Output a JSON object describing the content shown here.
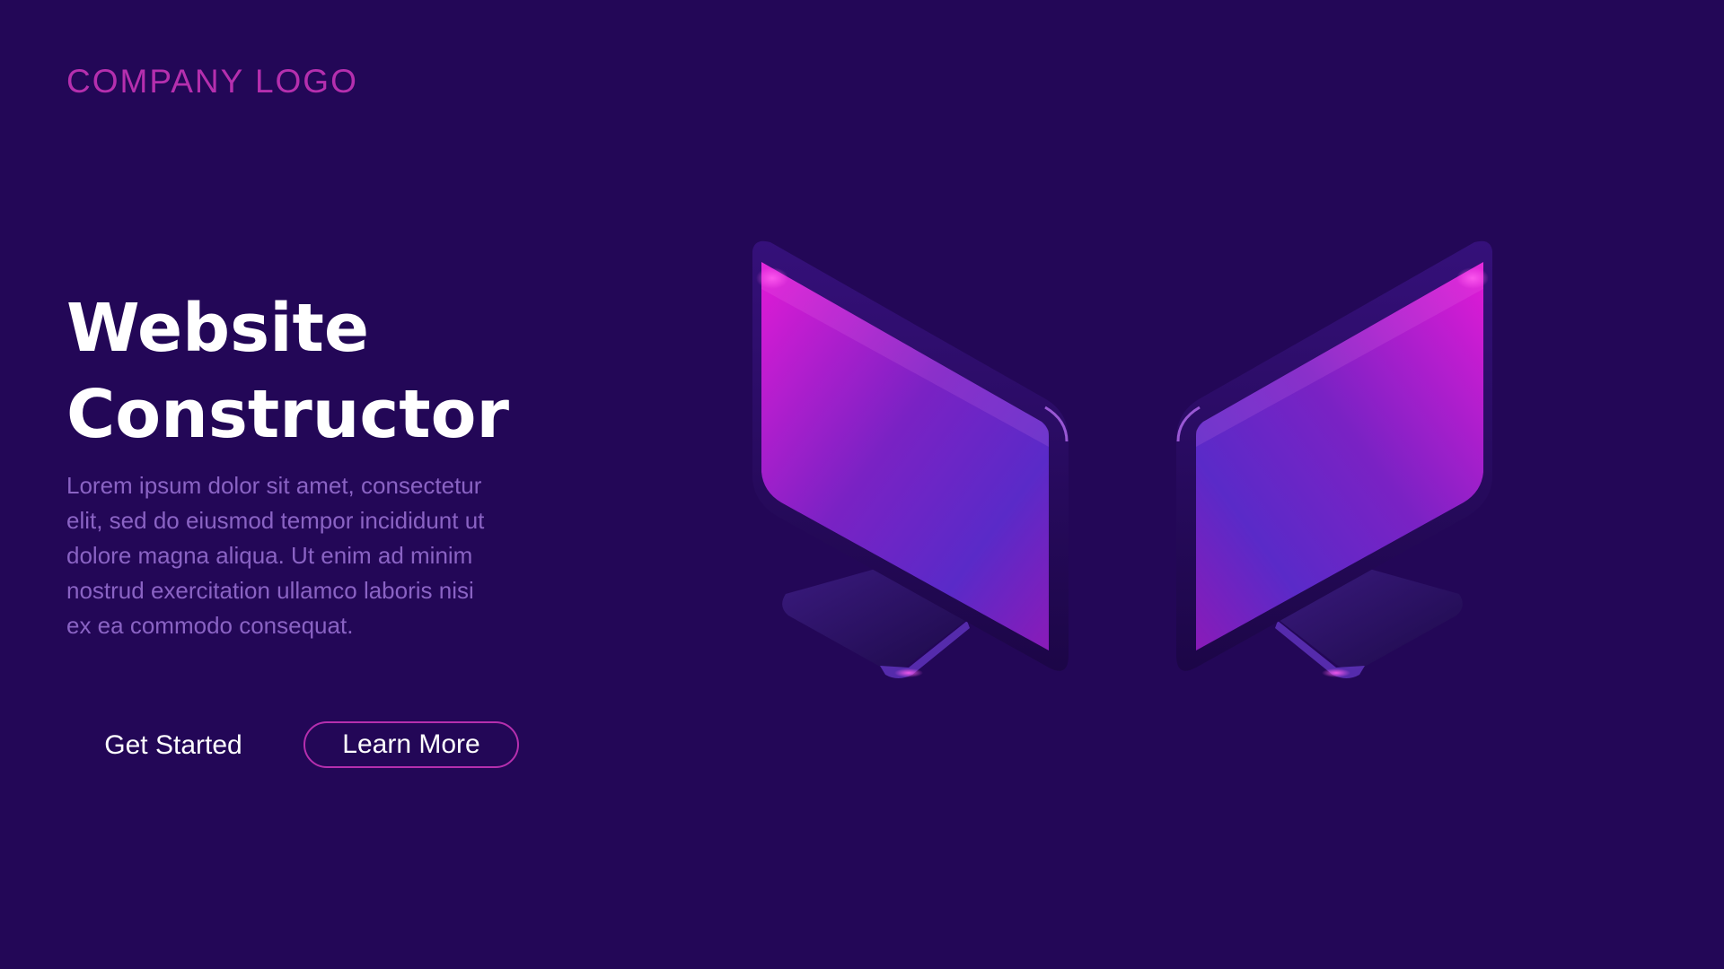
{
  "brand": {
    "logo_text": "COMPANY LOGO"
  },
  "hero": {
    "title_lines": [
      "Website",
      "Constructor"
    ],
    "description_lines": [
      "Lorem ipsum dolor sit amet, consectetur",
      "elit, sed do eiusmod tempor incididunt ut",
      "dolore magna aliqua. Ut enim ad minim",
      "nostrud exercitation ullamco laboris nisi",
      "ex ea commodo consequat."
    ]
  },
  "actions": {
    "get_started_label": "Get Started",
    "learn_more_label": "Learn More"
  },
  "illustration": {
    "icons": [
      "monitor-icon",
      "monitor-icon"
    ]
  },
  "colors": {
    "background": "#230757",
    "accent": "#b52fae",
    "title": "#ffffff",
    "body_text": "#8a63c4",
    "screen_top": "#e21ad6",
    "screen_bottom": "#5a2ac8"
  }
}
